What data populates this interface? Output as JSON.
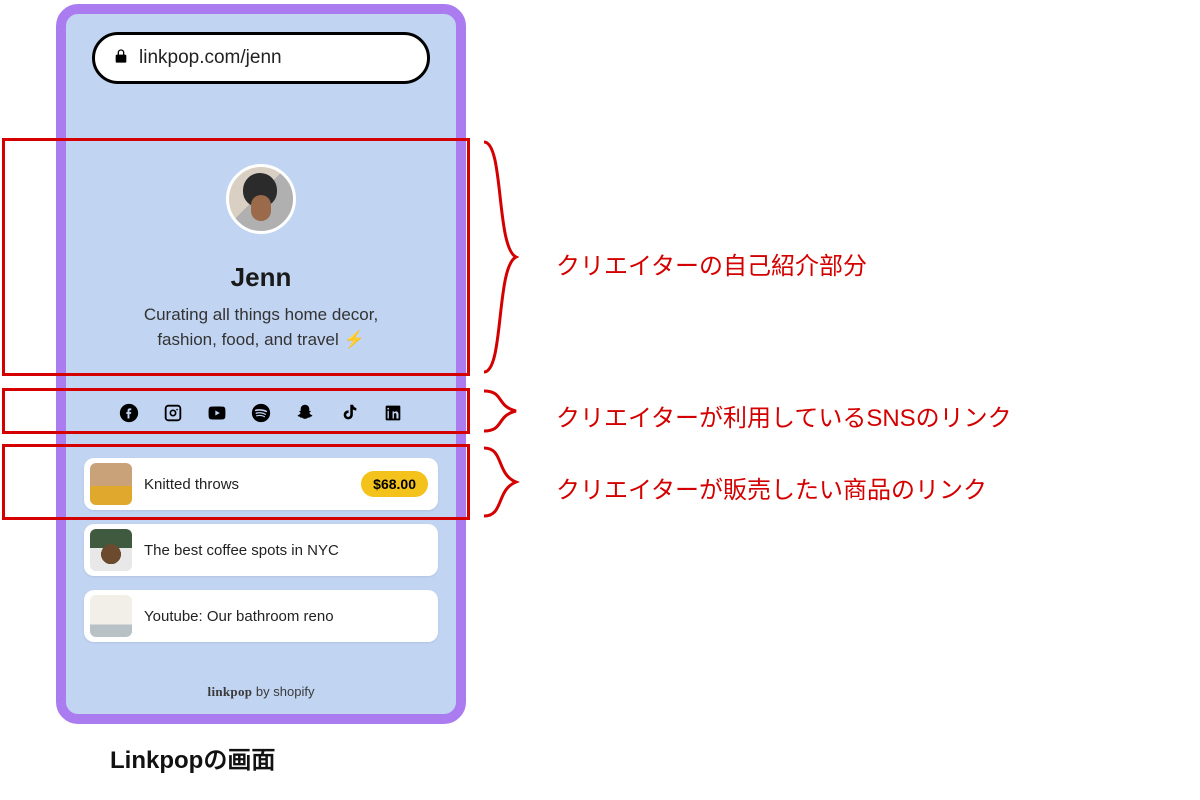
{
  "urlbar": {
    "text": "linkpop.com/jenn"
  },
  "profile": {
    "name": "Jenn",
    "bio_line1": "Curating all things home decor,",
    "bio_line2": "fashion, food, and travel ",
    "bolt": "⚡"
  },
  "social_icons": [
    "facebook",
    "instagram",
    "youtube",
    "spotify",
    "snapchat",
    "tiktok",
    "linkedin"
  ],
  "links": [
    {
      "title": "Knitted throws",
      "price": "$68.00"
    },
    {
      "title": "The best coffee spots in NYC"
    },
    {
      "title": "Youtube: Our bathroom reno"
    }
  ],
  "footer": {
    "brand": "linkpop",
    "by": " by shopify"
  },
  "caption": "Linkpopの画面",
  "annotations": {
    "a1": "クリエイターの自己紹介部分",
    "a2": "クリエイターが利用しているSNSのリンク",
    "a3": "クリエイターが販売したい商品のリンク"
  }
}
